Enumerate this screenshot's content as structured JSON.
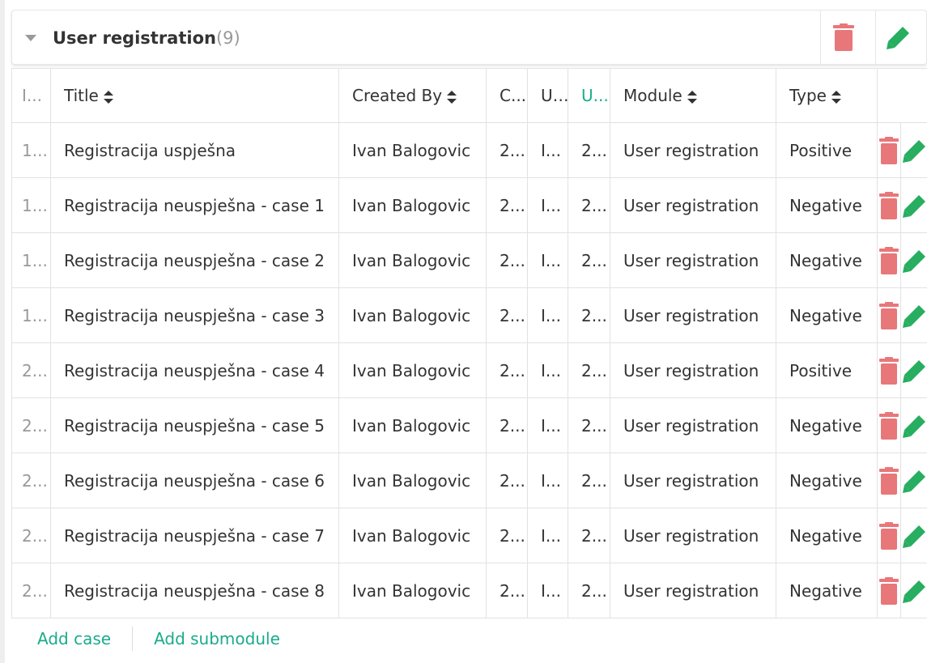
{
  "module": {
    "title": "User registration",
    "count": "(9)"
  },
  "colors": {
    "accent": "#1aab8a",
    "delete": "#e8777a",
    "edit": "#27ae60"
  },
  "icons": {
    "collapse": "caret-down-icon",
    "delete": "trash-icon",
    "edit": "pencil-icon",
    "sort": "sort-icon"
  },
  "table": {
    "columns": [
      "I...",
      "Title",
      "Created By",
      "C...",
      "U...",
      "U...",
      "Module",
      "Type",
      ""
    ],
    "rows": [
      {
        "id": "1...",
        "title": "Registracija uspješna",
        "created_by": "Ivan Balogovic",
        "c": "2...",
        "u1": "I...",
        "u2": "2...",
        "module": "User registration",
        "type": "Positive"
      },
      {
        "id": "1...",
        "title": "Registracija neuspješna - case 1",
        "created_by": "Ivan Balogovic",
        "c": "2...",
        "u1": "I...",
        "u2": "2...",
        "module": "User registration",
        "type": "Negative"
      },
      {
        "id": "1...",
        "title": "Registracija neuspješna - case 2",
        "created_by": "Ivan Balogovic",
        "c": "2...",
        "u1": "I...",
        "u2": "2...",
        "module": "User registration",
        "type": "Negative"
      },
      {
        "id": "1...",
        "title": "Registracija neuspješna - case 3",
        "created_by": "Ivan Balogovic",
        "c": "2...",
        "u1": "I...",
        "u2": "2...",
        "module": "User registration",
        "type": "Negative"
      },
      {
        "id": "2...",
        "title": "Registracija neuspješna - case 4",
        "created_by": "Ivan Balogovic",
        "c": "2...",
        "u1": "I...",
        "u2": "2...",
        "module": "User registration",
        "type": "Positive"
      },
      {
        "id": "2...",
        "title": "Registracija neuspješna - case 5",
        "created_by": "Ivan Balogovic",
        "c": "2...",
        "u1": "I...",
        "u2": "2...",
        "module": "User registration",
        "type": "Negative"
      },
      {
        "id": "2...",
        "title": "Registracija neuspješna - case 6",
        "created_by": "Ivan Balogovic",
        "c": "2...",
        "u1": "I...",
        "u2": "2...",
        "module": "User registration",
        "type": "Negative"
      },
      {
        "id": "2...",
        "title": "Registracija neuspješna - case 7",
        "created_by": "Ivan Balogovic",
        "c": "2...",
        "u1": "I...",
        "u2": "2...",
        "module": "User registration",
        "type": "Negative"
      },
      {
        "id": "2...",
        "title": "Registracija neuspješna - case 8",
        "created_by": "Ivan Balogovic",
        "c": "2...",
        "u1": "I...",
        "u2": "2...",
        "module": "User registration",
        "type": "Negative"
      }
    ]
  },
  "footer": {
    "add_case": "Add case",
    "add_submodule": "Add submodule"
  }
}
